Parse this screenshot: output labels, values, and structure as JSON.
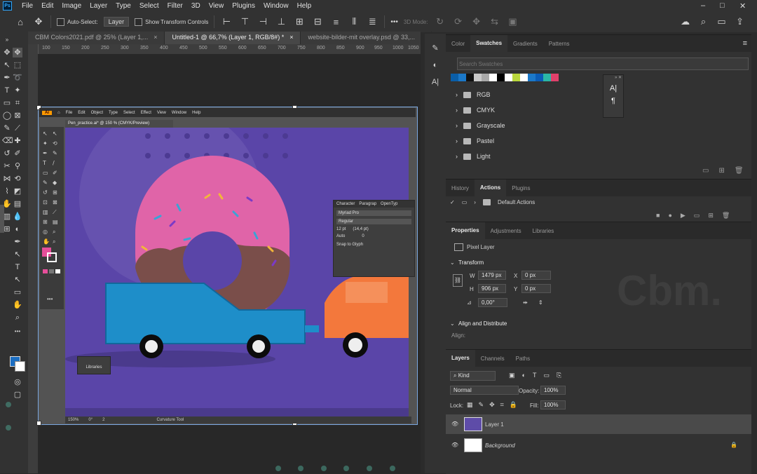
{
  "app": {
    "logo": "Ps",
    "window_controls": [
      "–",
      "□",
      "✕"
    ]
  },
  "menu": [
    "File",
    "Edit",
    "Image",
    "Layer",
    "Type",
    "Select",
    "Filter",
    "3D",
    "View",
    "Plugins",
    "Window",
    "Help"
  ],
  "options_bar": {
    "auto_select_label": "Auto-Select:",
    "layer_select": "Layer",
    "transform_label": "Show Transform Controls",
    "mode_3d": "3D Mode:",
    "more": "•••"
  },
  "tabs": [
    {
      "label": "CBM Colors2021.pdf @ 25% (Layer 1,...",
      "close": "×"
    },
    {
      "label": "Untitled-1 @ 66,7% (Layer 1, RGB/8#) *",
      "close": "×"
    },
    {
      "label": "website-bilder-mit overlay.psd @ 33,...",
      "close": "×"
    }
  ],
  "ruler_labels": [
    "100",
    "150",
    "200",
    "250",
    "300",
    "350",
    "400",
    "450",
    "500",
    "550",
    "600",
    "650",
    "700",
    "750",
    "800",
    "850",
    "900",
    "950",
    "1000",
    "1050"
  ],
  "illustrator": {
    "menu": [
      "File",
      "Edit",
      "Object",
      "Type",
      "Select",
      "Effect",
      "View",
      "Window",
      "Help"
    ],
    "tab": "Pen_practice.ai* @ 150 % (CMYK/Preview)",
    "status": {
      "zoom": "150%",
      "angle": "0°",
      "artboard": "2",
      "tool": "Curvature Tool"
    },
    "libraries": "Libraries",
    "character": {
      "tabs": [
        "Character",
        "Paragrap",
        "OpenTyp"
      ],
      "font": "Myriad Pro",
      "style": "Regular",
      "size": "12 pt",
      "leading": "(14,4 pt)",
      "kerning": "Auto",
      "tracking": "0",
      "snap": "Snap to Glyph"
    }
  },
  "swatches_panel": {
    "tabs": [
      "Color",
      "Swatches",
      "Gradients",
      "Patterns"
    ],
    "search_placeholder": "Search Swatches",
    "colors": [
      "#0a5ea8",
      "#1b78c8",
      "#111111",
      "#c9c9c9",
      "#a9a9a9",
      "#ffffff",
      "#000000",
      "#ffffff",
      "#b9d63c",
      "#ffffff",
      "#1b78c8",
      "#0b5bb5",
      "#2bb6a5",
      "#e0406a"
    ],
    "folders": [
      "RGB",
      "CMYK",
      "Grayscale",
      "Pastel",
      "Light"
    ]
  },
  "actions_panel": {
    "tabs": [
      "History",
      "Actions",
      "Plugins"
    ],
    "item": "Default Actions"
  },
  "properties_panel": {
    "tabs": [
      "Properties",
      "Adjustments",
      "Libraries"
    ],
    "kind": "Pixel Layer",
    "transform_label": "Transform",
    "w_label": "W",
    "w": "1479 px",
    "h_label": "H",
    "h": "906 px",
    "x_label": "X",
    "x": "0 px",
    "y_label": "Y",
    "y": "0 px",
    "angle": "0,00°",
    "align_label": "Align and Distribute",
    "align_sub": "Align:"
  },
  "layers_panel": {
    "tabs": [
      "Layers",
      "Channels",
      "Paths"
    ],
    "filter": "Kind",
    "blend": "Normal",
    "opacity_label": "Opacity:",
    "opacity": "100%",
    "lock_label": "Lock:",
    "fill_label": "Fill:",
    "fill": "100%",
    "layers": [
      {
        "name": "Layer 1"
      },
      {
        "name": "Background"
      }
    ]
  },
  "watermark": "Cbm.",
  "floating_panel": {
    "glyph_a": "A|",
    "glyph_p": "¶"
  }
}
